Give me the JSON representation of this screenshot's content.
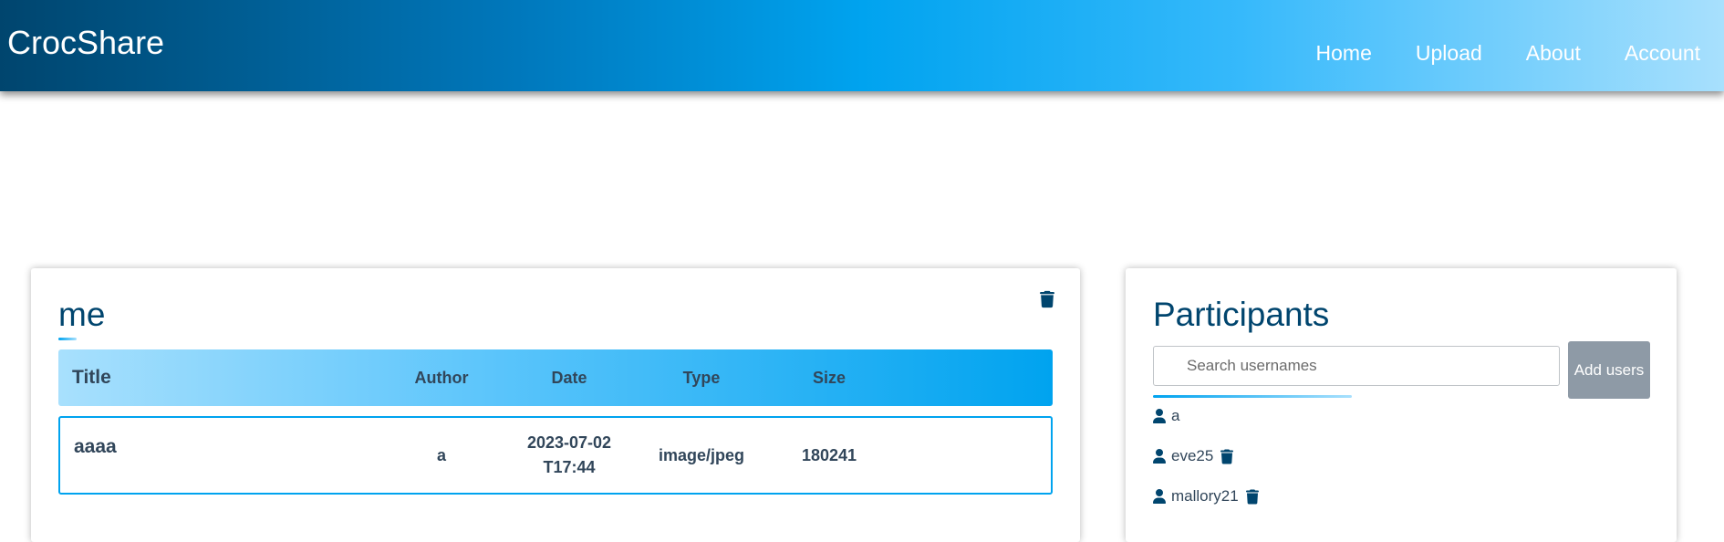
{
  "header": {
    "brand": "CrocShare",
    "nav": [
      {
        "label": "Home"
      },
      {
        "label": "Upload"
      },
      {
        "label": "About"
      },
      {
        "label": "Account"
      }
    ]
  },
  "folder": {
    "title": "me",
    "table": {
      "columns": [
        "Title",
        "Author",
        "Date",
        "Type",
        "Size"
      ],
      "rows": [
        {
          "title": "aaaa",
          "author": "a",
          "date": "2023-07-02T17:44",
          "type": "image/jpeg",
          "size": "180241"
        }
      ]
    }
  },
  "participants": {
    "title": "Participants",
    "search_placeholder": "Search usernames",
    "add_button_label": "Add users",
    "users": [
      {
        "name": "a",
        "removable": false
      },
      {
        "name": "eve25",
        "removable": true
      },
      {
        "name": "mallory21",
        "removable": true
      }
    ]
  },
  "colors": {
    "accent": "#00a3ef",
    "dark": "#00456e",
    "text": "#31465a",
    "button_disabled": "#8e9aa6"
  }
}
